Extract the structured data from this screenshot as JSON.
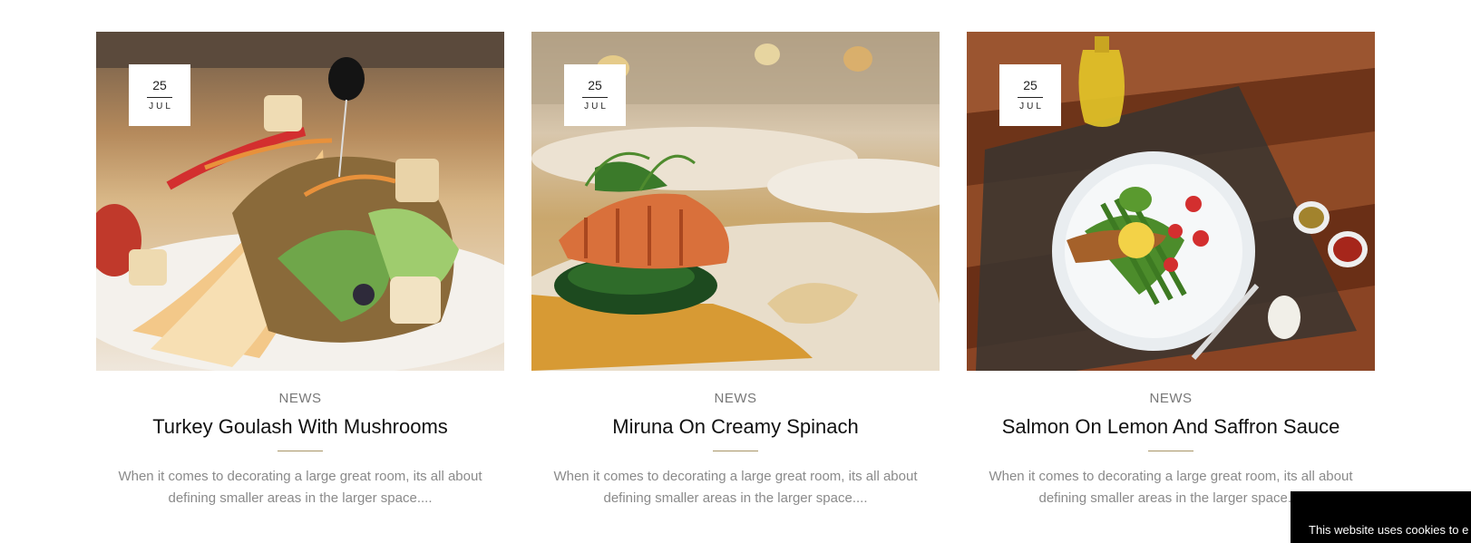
{
  "posts": [
    {
      "day": "25",
      "month": "JUL",
      "category": "NEWS",
      "title": "Turkey Goulash With Mushrooms",
      "excerpt": "When it comes to decorating a large great room, its all about defining smaller areas in the larger space...."
    },
    {
      "day": "25",
      "month": "JUL",
      "category": "NEWS",
      "title": "Miruna On Creamy Spinach",
      "excerpt": "When it comes to decorating a large great room, its all about defining smaller areas in the larger space...."
    },
    {
      "day": "25",
      "month": "JUL",
      "category": "NEWS",
      "title": "Salmon On Lemon And Saffron Sauce",
      "excerpt": "When it comes to decorating a large great room, its all about defining smaller areas in the larger space...."
    }
  ],
  "cookie": {
    "text": "This website uses cookies to e"
  },
  "colors": {
    "accent_rule": "#a89567",
    "cookie_bg": "#000000"
  }
}
